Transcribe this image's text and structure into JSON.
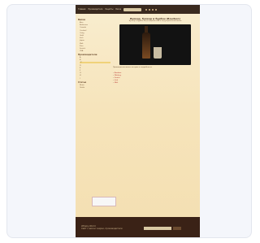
{
  "nav": {
    "items": [
      "Главная",
      "Производители",
      "Рецепты",
      "Виски"
    ],
    "search_placeholder": ""
  },
  "sidebar": {
    "sections": [
      {
        "title": "Виски",
        "items": [
          "Alex",
          "Baltimore",
          "Canada",
          "Cocktail",
          "Craig",
          "Gold",
          "Irish",
          "Japan",
          "Malt",
          "Pure",
          "Scotch",
          "USA"
        ]
      },
      {
        "title": "Производители",
        "items": [
          "A",
          "B",
          "C",
          "D",
          "E",
          "F",
          "G",
          "H",
          "I"
        ]
      },
      {
        "title": "Статьи",
        "items": [
          "News",
          "Guide"
        ]
      }
    ]
  },
  "main": {
    "title": "Буккер, буккер и бурбон (Bourbon)",
    "subtitle": "Буккер и бурбон-лицензированный и индустриальный виски",
    "caption": "Производство виски, история и подробности.",
    "bullets": [
      "Bourbon",
      "Whiskey",
      "Scotch",
      "Irish",
      "Malt"
    ]
  },
  "footer": {
    "left_text": "Whisky World",
    "left_sub": "Сайт о виски: марки, производители"
  }
}
